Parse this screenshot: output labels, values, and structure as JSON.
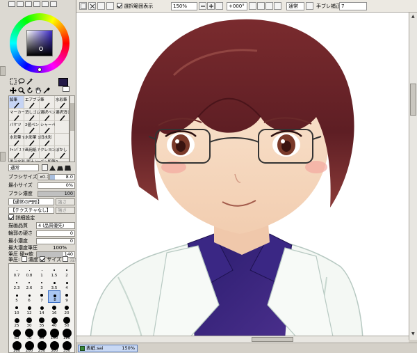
{
  "toolbar": {
    "selection_display_label": "選択範囲表示",
    "selection_display_checked": true,
    "zoom_value": "150%",
    "rotation_value": "+000°",
    "blend_value": "通常",
    "stabilizer_label": "手ブレ補正",
    "stabilizer_value": "7"
  },
  "colors": {
    "main": "#241a48",
    "sub": "#ffffff",
    "wheel_hue": "#3a28c8",
    "selected_highlight": "#c6d4f4"
  },
  "brush_tools": [
    {
      "label": "鉛筆",
      "icon": "pencil-icon",
      "selected": true
    },
    {
      "label": "エアブラシ",
      "icon": "airbrush-icon",
      "selected": false
    },
    {
      "label": "筆",
      "icon": "brush-icon",
      "selected": false
    },
    {
      "label": "水彩筆",
      "icon": "watercolor-icon",
      "selected": false
    },
    {
      "label": "マーカー",
      "icon": "marker-icon",
      "selected": false
    },
    {
      "label": "消しゴム",
      "icon": "eraser-icon",
      "selected": false
    },
    {
      "label": "選択ペン",
      "icon": "select-pen-icon",
      "selected": false
    },
    {
      "label": "選択消し",
      "icon": "select-eraser-icon",
      "selected": false
    },
    {
      "label": "バケツ",
      "icon": "bucket-icon",
      "selected": false
    },
    {
      "label": "2値ペン",
      "icon": "binary-pen-icon",
      "selected": false
    },
    {
      "label": "シャーペ",
      "icon": "mechanical-pencil-icon",
      "selected": false
    },
    {
      "label": "",
      "icon": "",
      "selected": false
    },
    {
      "label": "水彩筆 9細",
      "icon": "watercolor-icon",
      "selected": false
    },
    {
      "label": "水彩筆 10細",
      "icon": "watercolor-icon",
      "selected": false
    },
    {
      "label": "旧水彩",
      "icon": "watercolor-icon",
      "selected": false
    },
    {
      "label": "",
      "icon": "",
      "selected": false
    },
    {
      "label": "ｷｬﾝﾊﾞｽ ｱｸﾘﾙ",
      "icon": "canvas-acrylic-icon",
      "selected": false
    },
    {
      "label": "画用紙 ｱｸﾘﾙ",
      "icon": "paper-acrylic-icon",
      "selected": false
    },
    {
      "label": "クレヨン",
      "icon": "crayon-icon",
      "selected": false
    },
    {
      "label": "ぼかし",
      "icon": "blur-icon",
      "selected": false
    }
  ],
  "brush_tools_extra_row": "墨汁水彩 墨汁 ｼｬｰﾌﾟﾝ 鉛筆2",
  "props": {
    "blend_mode": "通常",
    "brush_size_label": "ブラシサイズ",
    "brush_size_mult": "x0.1",
    "brush_size_value": "8.0",
    "min_size_label": "最小サイズ",
    "min_size_value": "0%",
    "min_size_fraction": 0.0,
    "density_label": "ブラシ濃度",
    "density_value": "100",
    "density_fraction": 1.0,
    "shape_select": "【通常の円形】",
    "texture_select": "【テクスチャなし】",
    "shape_strength": "強さ",
    "texture_strength": "強さ",
    "detail_label": "詳細設定",
    "detail_checked": true,
    "quality_label": "描画品質",
    "quality_value": "4 (品質優先)",
    "edge_label": "輪郭の硬さ",
    "edge_value": "0",
    "min_density_label": "最小濃度",
    "min_density_value": "0",
    "max_density_pressure_label": "最大濃度筆圧",
    "max_density_pressure_value": "100%",
    "pressure_hardness_label": "筆圧 硬⇔軟",
    "pressure_hardness_value": "140",
    "pressure_label": "筆圧:",
    "pressure_density_label": "濃度",
    "pressure_density_checked": false,
    "pressure_size_label": "サイズ",
    "pressure_size_checked": true,
    "pressure_blend_label": "混色"
  },
  "size_presets": [
    "0.7",
    "0.8",
    "1",
    "1.5",
    "2",
    "2.3",
    "2.6",
    "3",
    "3.5",
    "4",
    "5",
    "6",
    "7",
    "8",
    "9",
    "10",
    "12",
    "14",
    "16",
    "20",
    "25",
    "30",
    "35",
    "40",
    "50",
    "60",
    "70",
    "80",
    "100",
    "120",
    "160",
    "200",
    "250",
    "300",
    "350"
  ],
  "size_selected": "8",
  "document": {
    "tab_name": "表紙.sai",
    "tab_zoom": "150%"
  }
}
